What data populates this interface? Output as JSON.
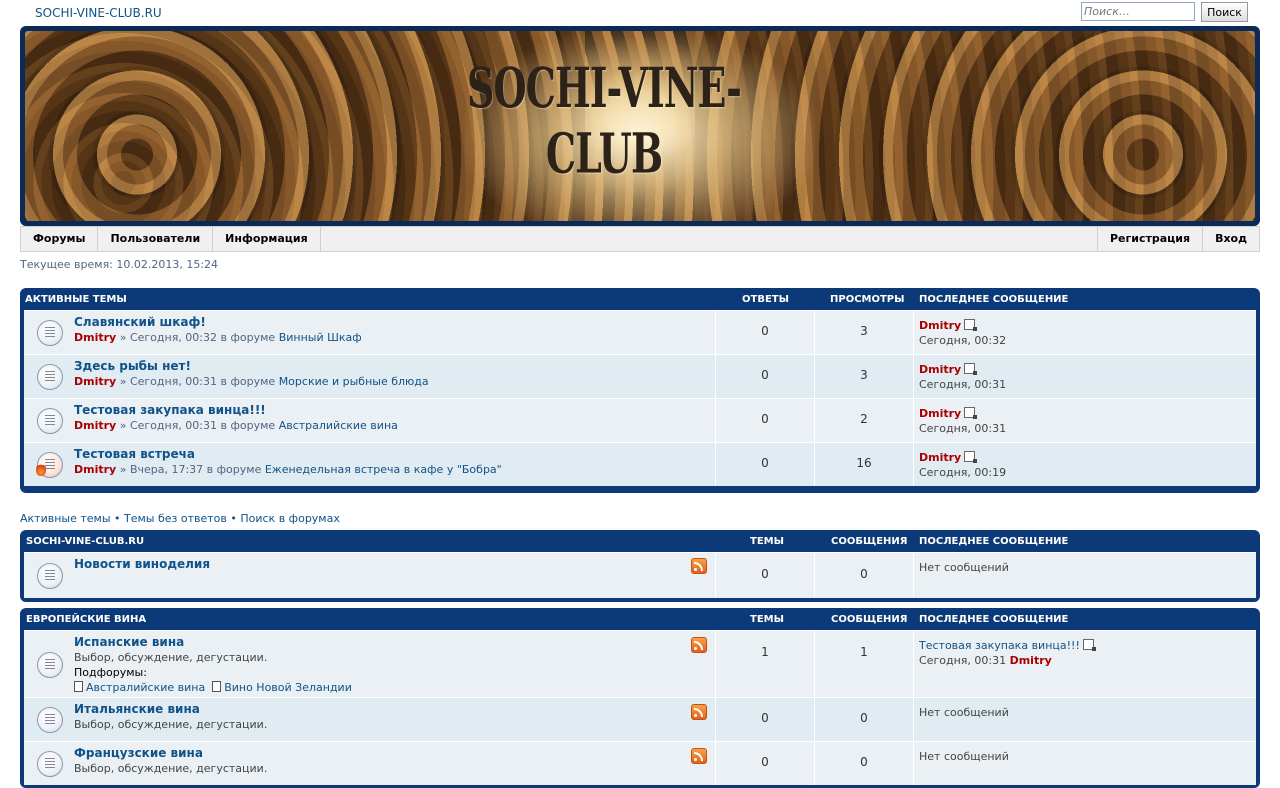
{
  "site": {
    "title_link": "SOCHI-VINE-CLUB.RU",
    "banner_text": "SOCHI-VINE-CLUB"
  },
  "search": {
    "placeholder": "Поиск…",
    "button_label": "Поиск"
  },
  "nav": {
    "left": [
      "Форумы",
      "Пользователи",
      "Информация"
    ],
    "right": [
      "Регистрация",
      "Вход"
    ]
  },
  "current_time": "Текущее время: 10.02.2013, 15:24",
  "active_topics": {
    "headers": {
      "title": "АКТИВНЫЕ ТЕМЫ",
      "replies": "ОТВЕТЫ",
      "views": "ПРОСМОТРЫ",
      "last": "ПОСЛЕДНЕЕ СООБЩЕНИЕ"
    },
    "rows": [
      {
        "title": "Славянский шкаф!",
        "author": "Dmitry",
        "meta": "» Сегодня, 00:32 в форуме ",
        "forum": "Винный Шкаф",
        "replies": "0",
        "views": "3",
        "last_user": "Dmitry",
        "last_time": "Сегодня, 00:32",
        "hot": false
      },
      {
        "title": "Здесь рыбы нет!",
        "author": "Dmitry",
        "meta": "» Сегодня, 00:31 в форуме ",
        "forum": "Морские и рыбные блюда",
        "replies": "0",
        "views": "3",
        "last_user": "Dmitry",
        "last_time": "Сегодня, 00:31",
        "hot": false
      },
      {
        "title": "Тестовая закупака винца!!!",
        "author": "Dmitry",
        "meta": "» Сегодня, 00:31 в форуме ",
        "forum": "Австралийские вина",
        "replies": "0",
        "views": "2",
        "last_user": "Dmitry",
        "last_time": "Сегодня, 00:31",
        "hot": false
      },
      {
        "title": "Тестовая встреча",
        "author": "Dmitry",
        "meta": "» Вчера, 17:37 в форуме ",
        "forum": "Еженедельная встреча в кафе у \"Бобра\"",
        "replies": "0",
        "views": "16",
        "last_user": "Dmitry",
        "last_time": "Сегодня, 00:19",
        "hot": true
      }
    ]
  },
  "quicklinks": {
    "active": "Активные темы",
    "unanswered": "Темы без ответов",
    "search": "Поиск в форумах",
    "sep": " • "
  },
  "category1": {
    "headers": {
      "title": "SOCHI-VINE-CLUB.RU",
      "topics": "ТЕМЫ",
      "posts": "СООБЩЕНИЯ",
      "last": "ПОСЛЕДНЕЕ СООБЩЕНИЕ"
    },
    "forum": {
      "title": "Новости виноделия",
      "topics": "0",
      "posts": "0",
      "last": "Нет сообщений"
    }
  },
  "category2": {
    "headers": {
      "title": "ЕВРОПЕЙСКИЕ ВИНА",
      "topics": "ТЕМЫ",
      "posts": "СООБЩЕНИЯ",
      "last": "ПОСЛЕДНЕЕ СООБЩЕНИЕ"
    },
    "forums": [
      {
        "title": "Испанские вина",
        "desc": "Выбор, обсуждение, дегустации.",
        "subforums_label": "Подфорумы:",
        "subforums": [
          "Австралийские вина",
          "Вино Новой Зеландии"
        ],
        "topics": "1",
        "posts": "1",
        "last_title": "Тестовая закупака винца!!!",
        "last_time": "Сегодня, 00:31",
        "last_user": "Dmitry"
      },
      {
        "title": "Итальянские вина",
        "desc": "Выбор, обсуждение, дегустации.",
        "topics": "0",
        "posts": "0",
        "last": "Нет сообщений"
      },
      {
        "title": "Французские вина",
        "desc": "Выбор, обсуждение, дегустации.",
        "topics": "0",
        "posts": "0",
        "last": "Нет сообщений"
      }
    ]
  }
}
